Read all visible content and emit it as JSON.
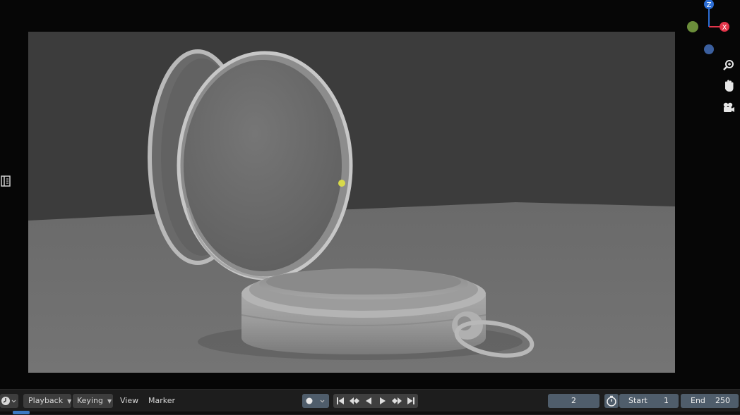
{
  "viewport": {
    "gizmo": {
      "z_label": "Z",
      "x_label": "X"
    },
    "nav_icons": [
      "zoom-icon",
      "pan-hand-icon",
      "camera-icon"
    ]
  },
  "timeline": {
    "editor_type_icon": "clock-icon",
    "menus": {
      "playback": "Playback",
      "keying": "Keying",
      "view": "View",
      "marker": "Marker"
    },
    "current_frame": "2",
    "start_label": "Start",
    "start_value": "1",
    "end_label": "End",
    "end_value": "250"
  },
  "colors": {
    "axis_z": "#2d6fd6",
    "axis_x": "#e2354a",
    "axis_y": "#6b8e3a",
    "field_blue": "#4f5d6b",
    "light_point": "#d7d94a"
  }
}
